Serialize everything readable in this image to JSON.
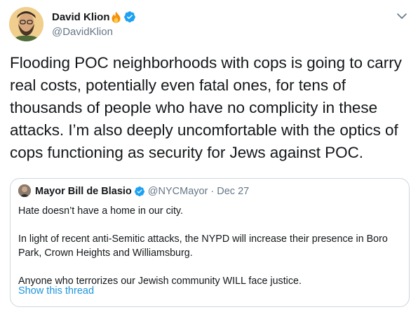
{
  "author": {
    "name": "David Klion",
    "handle": "@DavidKlion",
    "verified": true,
    "name_emoji": "fire-icon"
  },
  "tweet": {
    "text": "Flooding POC neighborhoods with cops is going to carry real costs, potentially even fatal ones, for tens of thousands of people who have no complicity in these attacks. I’m also deeply uncomfortable with the optics of cops functioning as security for Jews against POC."
  },
  "quoted": {
    "name": "Mayor Bill de Blasio",
    "handle": "@NYCMayor",
    "separator": "·",
    "date": "Dec 27",
    "verified": true,
    "paragraphs": [
      "Hate doesn’t have a home in our city.",
      "In light of recent anti-Semitic attacks, the NYPD will increase their presence in Boro Park, Crown Heights and Williamsburg.",
      "Anyone who terrorizes our Jewish community WILL face justice."
    ],
    "show_thread": "Show this thread"
  },
  "colors": {
    "text": "#14171a",
    "secondary": "#657786",
    "link": "#1b95e0",
    "border": "#ccd6dd",
    "verified": "#1da1f2"
  },
  "icons": [
    "verified-badge-icon",
    "fire-icon",
    "chevron-down-icon"
  ]
}
